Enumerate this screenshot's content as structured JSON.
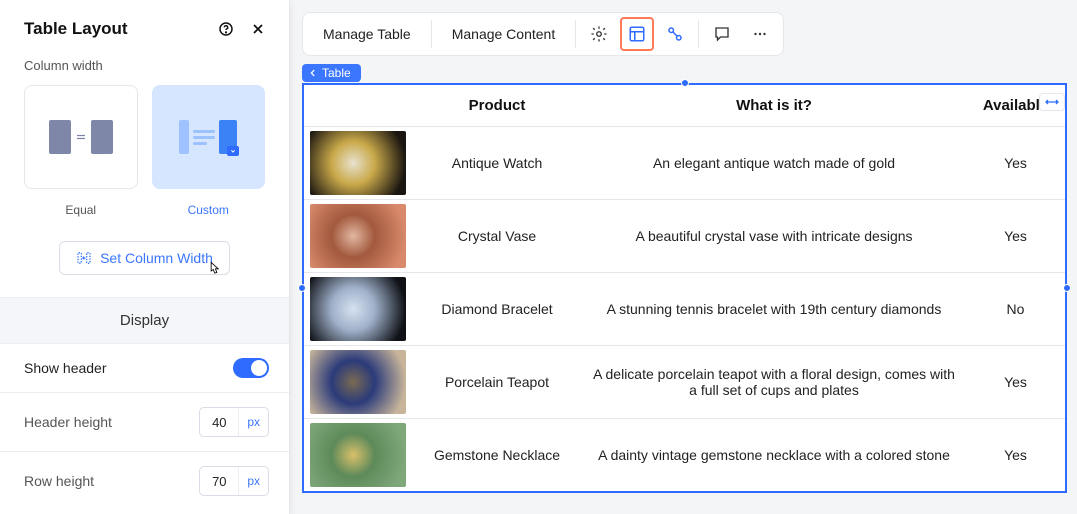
{
  "sidebar": {
    "title": "Table Layout",
    "column_width_label": "Column width",
    "options": {
      "equal": "Equal",
      "custom": "Custom"
    },
    "set_column_width": "Set Column Width",
    "display_header": "Display",
    "show_header_label": "Show header",
    "show_header_on": true,
    "header_height_label": "Header height",
    "header_height_value": "40",
    "row_height_label": "Row height",
    "row_height_value": "70",
    "unit": "px"
  },
  "toolbar": {
    "manage_table": "Manage Table",
    "manage_content": "Manage Content"
  },
  "breadcrumb": "Table",
  "table": {
    "headers": [
      "",
      "Product",
      "What is it?",
      "Available"
    ],
    "rows": [
      {
        "product": "Antique Watch",
        "desc": "An elegant antique watch made of gold",
        "available": "Yes",
        "thumb_colors": [
          "#1a1510",
          "#c9a94a",
          "#e8e2cf"
        ]
      },
      {
        "product": "Crystal Vase",
        "desc": "A beautiful crystal vase with intricate designs",
        "available": "Yes",
        "thumb_colors": [
          "#d88a6b",
          "#a2593e",
          "#e2b7a0"
        ]
      },
      {
        "product": "Diamond Bracelet",
        "desc": "A stunning tennis bracelet with 19th century diamonds",
        "available": "No",
        "thumb_colors": [
          "#0f1117",
          "#9fb0c9",
          "#d7e2f0"
        ]
      },
      {
        "product": "Porcelain Teapot",
        "desc": "A delicate porcelain teapot with a floral design, comes with a full set of cups and plates",
        "available": "Yes",
        "thumb_colors": [
          "#c7b49a",
          "#2b3b7a",
          "#7a6a52"
        ]
      },
      {
        "product": "Gemstone Necklace",
        "desc": "A dainty vintage gemstone necklace with a colored stone",
        "available": "Yes",
        "thumb_colors": [
          "#7fa87a",
          "#5e8a5a",
          "#d9c06a"
        ]
      }
    ]
  }
}
